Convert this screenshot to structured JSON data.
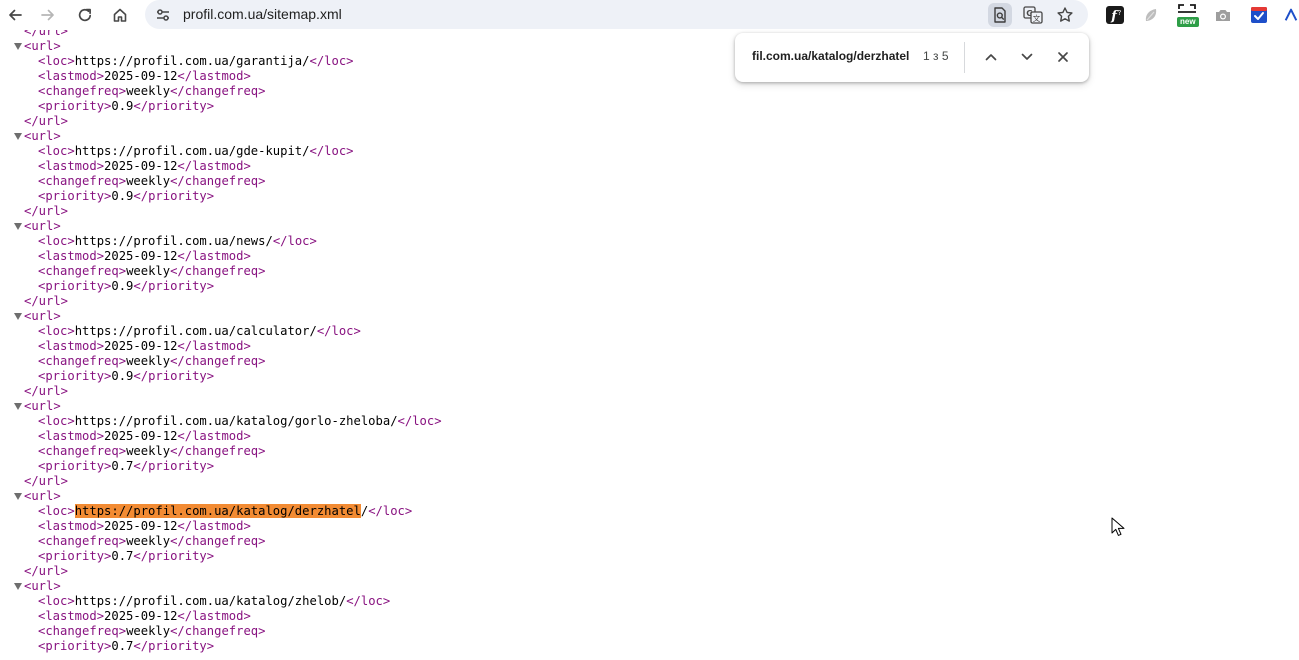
{
  "browser": {
    "url": "profil.com.ua/sitemap.xml"
  },
  "find": {
    "query": "fil.com.ua/katalog/derzhatel",
    "count": "1 з 5"
  },
  "extensions": {
    "new_badge": "new"
  },
  "colors": {
    "tag": "#881280",
    "highlight": "#f28b33",
    "omnibox_bg": "#eef1f7"
  },
  "xml": {
    "top_partial": "</url>",
    "blocks": [
      {
        "open": "<url>",
        "loc_open": "<loc>",
        "loc": "https://profil.com.ua/garantija/",
        "loc_close": "</loc>",
        "lastmod_open": "<lastmod>",
        "lastmod": "2025-09-12",
        "lastmod_close": "</lastmod>",
        "changefreq_open": "<changefreq>",
        "changefreq": "weekly",
        "changefreq_close": "</changefreq>",
        "priority_open": "<priority>",
        "priority": "0.9",
        "priority_close": "</priority>",
        "close": "</url>"
      },
      {
        "open": "<url>",
        "loc_open": "<loc>",
        "loc": "https://profil.com.ua/gde-kupit/",
        "loc_close": "</loc>",
        "lastmod_open": "<lastmod>",
        "lastmod": "2025-09-12",
        "lastmod_close": "</lastmod>",
        "changefreq_open": "<changefreq>",
        "changefreq": "weekly",
        "changefreq_close": "</changefreq>",
        "priority_open": "<priority>",
        "priority": "0.9",
        "priority_close": "</priority>",
        "close": "</url>"
      },
      {
        "open": "<url>",
        "loc_open": "<loc>",
        "loc": "https://profil.com.ua/news/",
        "loc_close": "</loc>",
        "lastmod_open": "<lastmod>",
        "lastmod": "2025-09-12",
        "lastmod_close": "</lastmod>",
        "changefreq_open": "<changefreq>",
        "changefreq": "weekly",
        "changefreq_close": "</changefreq>",
        "priority_open": "<priority>",
        "priority": "0.9",
        "priority_close": "</priority>",
        "close": "</url>"
      },
      {
        "open": "<url>",
        "loc_open": "<loc>",
        "loc": "https://profil.com.ua/calculator/",
        "loc_close": "</loc>",
        "lastmod_open": "<lastmod>",
        "lastmod": "2025-09-12",
        "lastmod_close": "</lastmod>",
        "changefreq_open": "<changefreq>",
        "changefreq": "weekly",
        "changefreq_close": "</changefreq>",
        "priority_open": "<priority>",
        "priority": "0.9",
        "priority_close": "</priority>",
        "close": "</url>"
      },
      {
        "open": "<url>",
        "loc_open": "<loc>",
        "loc": "https://profil.com.ua/katalog/gorlo-zheloba/",
        "loc_close": "</loc>",
        "lastmod_open": "<lastmod>",
        "lastmod": "2025-09-12",
        "lastmod_close": "</lastmod>",
        "changefreq_open": "<changefreq>",
        "changefreq": "weekly",
        "changefreq_close": "</changefreq>",
        "priority_open": "<priority>",
        "priority": "0.7",
        "priority_close": "</priority>",
        "close": "</url>"
      },
      {
        "open": "<url>",
        "loc_open": "<loc>",
        "loc_highlight": "https://profil.com.ua/katalog/derzhatel",
        "loc_rest": "/",
        "loc_close": "</loc>",
        "lastmod_open": "<lastmod>",
        "lastmod": "2025-09-12",
        "lastmod_close": "</lastmod>",
        "changefreq_open": "<changefreq>",
        "changefreq": "weekly",
        "changefreq_close": "</changefreq>",
        "priority_open": "<priority>",
        "priority": "0.7",
        "priority_close": "</priority>",
        "close": "</url>"
      },
      {
        "open": "<url>",
        "loc_open": "<loc>",
        "loc": "https://profil.com.ua/katalog/zhelob/",
        "loc_close": "</loc>",
        "lastmod_open": "<lastmod>",
        "lastmod": "2025-09-12",
        "lastmod_close": "</lastmod>",
        "changefreq_open": "<changefreq>",
        "changefreq": "weekly",
        "changefreq_close": "</changefreq>",
        "priority_open": "<priority>",
        "priority": "0.7",
        "priority_close": "</priority>"
      }
    ]
  }
}
